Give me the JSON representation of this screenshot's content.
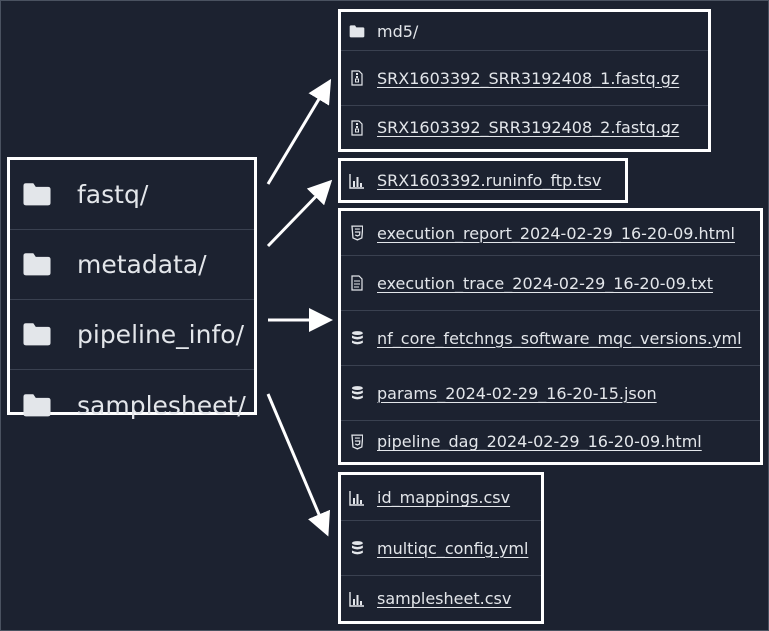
{
  "directories": [
    {
      "name": "fastq/",
      "icon": "folder-icon"
    },
    {
      "name": "metadata/",
      "icon": "folder-icon"
    },
    {
      "name": "pipeline_info/",
      "icon": "folder-icon"
    },
    {
      "name": "samplesheet/",
      "icon": "folder-icon"
    }
  ],
  "fastq_contents": [
    {
      "name": "md5/",
      "icon": "folder-icon"
    },
    {
      "name": "SRX1603392_SRR3192408_1.fastq.gz",
      "icon": "archive-file-icon"
    },
    {
      "name": "SRX1603392_SRR3192408_2.fastq.gz",
      "icon": "archive-file-icon"
    }
  ],
  "metadata_contents": [
    {
      "name": "SRX1603392.runinfo_ftp.tsv",
      "icon": "chart-file-icon"
    }
  ],
  "pipeline_info_contents": [
    {
      "name": "execution_report_2024-02-29_16-20-09.html",
      "icon": "html-file-icon"
    },
    {
      "name": "execution_trace_2024-02-29_16-20-09.txt",
      "icon": "text-file-icon"
    },
    {
      "name": "nf_core_fetchngs_software_mqc_versions.yml",
      "icon": "database-file-icon"
    },
    {
      "name": "params_2024-02-29_16-20-15.json",
      "icon": "database-file-icon"
    },
    {
      "name": "pipeline_dag_2024-02-29_16-20-09.html",
      "icon": "html-file-icon"
    }
  ],
  "samplesheet_contents": [
    {
      "name": "id_mappings.csv",
      "icon": "chart-file-icon"
    },
    {
      "name": "multiqc_config.yml",
      "icon": "database-file-icon"
    },
    {
      "name": "samplesheet.csv",
      "icon": "chart-file-icon"
    }
  ],
  "colors": {
    "background": "#1c2230",
    "border": "#ffffff",
    "text": "#e3e6ea",
    "divider": "#3a4150"
  }
}
